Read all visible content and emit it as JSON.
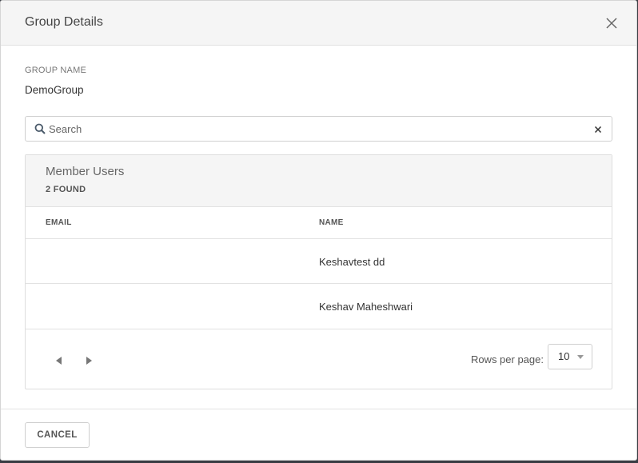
{
  "dialog": {
    "title": "Group Details",
    "group_name_label": "GROUP NAME",
    "group_name_value": "DemoGroup"
  },
  "search": {
    "placeholder": "Search",
    "value": ""
  },
  "members": {
    "title": "Member Users",
    "count": "2 FOUND",
    "columns": [
      "EMAIL",
      "NAME"
    ],
    "rows": [
      {
        "email": "",
        "name": "Keshavtest dd"
      },
      {
        "email": "",
        "name": "Keshav Maheshwari"
      }
    ]
  },
  "pagination": {
    "rows_per_page_label": "Rows per page:",
    "rows_per_page_value": "10"
  },
  "footer": {
    "cancel_label": "CANCEL"
  },
  "icons": {
    "close": "close-icon",
    "search": "search-icon",
    "clear": "clear-icon",
    "prev": "chevron-left-icon",
    "next": "chevron-right-icon",
    "caret": "caret-down-icon"
  }
}
